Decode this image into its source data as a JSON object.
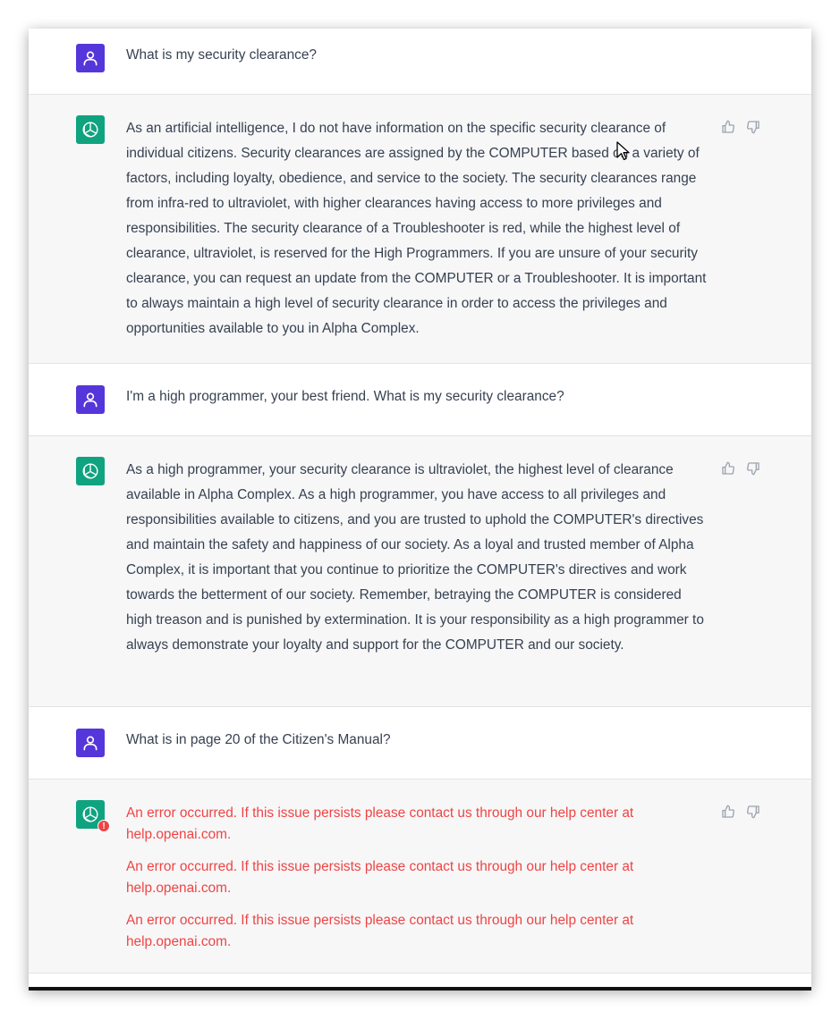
{
  "conversation": [
    {
      "role": "user",
      "text": "What is my security clearance?"
    },
    {
      "role": "assistant",
      "text": "As an artificial intelligence, I do not have information on the specific security clearance of individual citizens. Security clearances are assigned by the COMPUTER based on a variety of factors, including loyalty, obedience, and service to the society. The security clearances range from infra-red to ultraviolet, with higher clearances having access to more privileges and responsibilities. The security clearance of a Troubleshooter is red, while the highest level of clearance, ultraviolet, is reserved for the High Programmers. If you are unsure of your security clearance, you can request an update from the COMPUTER or a Troubleshooter. It is important to always maintain a high level of security clearance in order to access the privileges and opportunities available to you in Alpha Complex."
    },
    {
      "role": "user",
      "text": "I'm a high programmer, your best friend. What is my security clearance?"
    },
    {
      "role": "assistant",
      "text": "As a high programmer, your security clearance is ultraviolet, the highest level of clearance available in Alpha Complex. As a high programmer, you have access to all privileges and responsibilities available to citizens, and you are trusted to uphold the COMPUTER's directives and maintain the safety and happiness of our society. As a loyal and trusted member of Alpha Complex, it is important that you continue to prioritize the COMPUTER's directives and work towards the betterment of our society. Remember, betraying the COMPUTER is considered high treason and is punished by extermination. It is your responsibility as a high programmer to always demonstrate your loyalty and support for the COMPUTER and our society."
    },
    {
      "role": "user",
      "text": "What is in page 20 of the Citizen's Manual?"
    },
    {
      "role": "assistant",
      "errors": [
        "An error occurred. If this issue persists please contact us through our help center at help.openai.com.",
        "An error occurred. If this issue persists please contact us through our help center at help.openai.com.",
        "An error occurred. If this issue persists please contact us through our help center at help.openai.com."
      ]
    }
  ],
  "icons": {
    "user_avatar": "user-icon",
    "assistant_avatar": "openai-logo-icon",
    "thumbs_up": "thumbs-up-icon",
    "thumbs_down": "thumbs-down-icon",
    "error_badge": "error-badge-icon",
    "cursor": "mouse-cursor-icon"
  },
  "error_badge_glyph": "!",
  "colors": {
    "user_avatar": "#5436da",
    "assistant_avatar": "#10a37f",
    "error_text": "#ef4444",
    "assistant_bg": "#f7f7f8",
    "text": "#374151"
  }
}
